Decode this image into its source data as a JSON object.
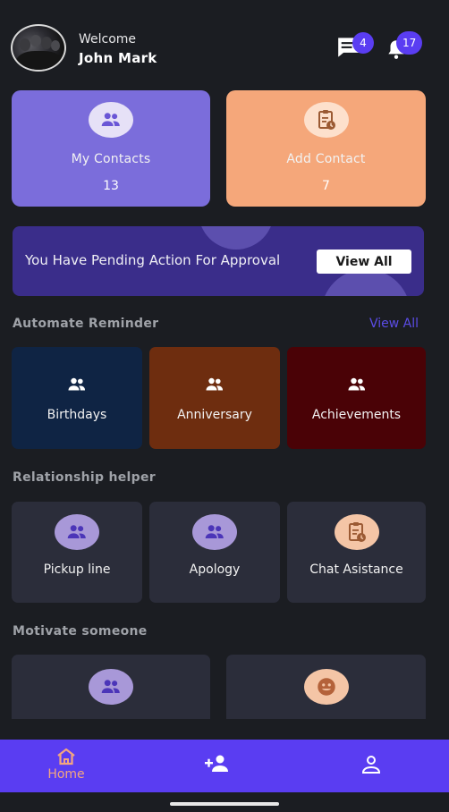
{
  "header": {
    "welcome": "Welcome",
    "username": "John Mark",
    "messages_badge": "4",
    "notifications_badge": "17"
  },
  "top_cards": [
    {
      "label": "My Contacts",
      "count": "13",
      "color": "#7b6ddb",
      "icon": "contacts-icon"
    },
    {
      "label": "Add Contact",
      "count": "7",
      "color": "#f5a77a",
      "icon": "clipboard-icon"
    }
  ],
  "banner": {
    "text": "You Have Pending Action For Approval",
    "button": "View All"
  },
  "automate": {
    "title": "Automate Reminder",
    "view_all": "View All",
    "items": [
      {
        "label": "Birthdays",
        "color": "#0f2444"
      },
      {
        "label": "Anniversary",
        "color": "#6e2d0f"
      },
      {
        "label": "Achievements",
        "color": "#4a0206"
      }
    ]
  },
  "helper": {
    "title": "Relationship helper",
    "items": [
      {
        "label": "Pickup line",
        "icon": "contacts-icon"
      },
      {
        "label": "Apology",
        "icon": "contacts-icon"
      },
      {
        "label": "Chat Asistance",
        "icon": "clipboard-icon"
      }
    ]
  },
  "motivate": {
    "title": "Motivate someone",
    "items": [
      {
        "icon": "contacts-icon"
      },
      {
        "icon": "smiley-icon"
      }
    ]
  },
  "nav": {
    "home": "Home",
    "add_user_icon": "add-user-icon",
    "profile_icon": "profile-icon"
  },
  "colors": {
    "accent": "#5a3df2",
    "background": "#1b1d22",
    "card": "#2b2d3a",
    "home_label": "#f3a680"
  }
}
